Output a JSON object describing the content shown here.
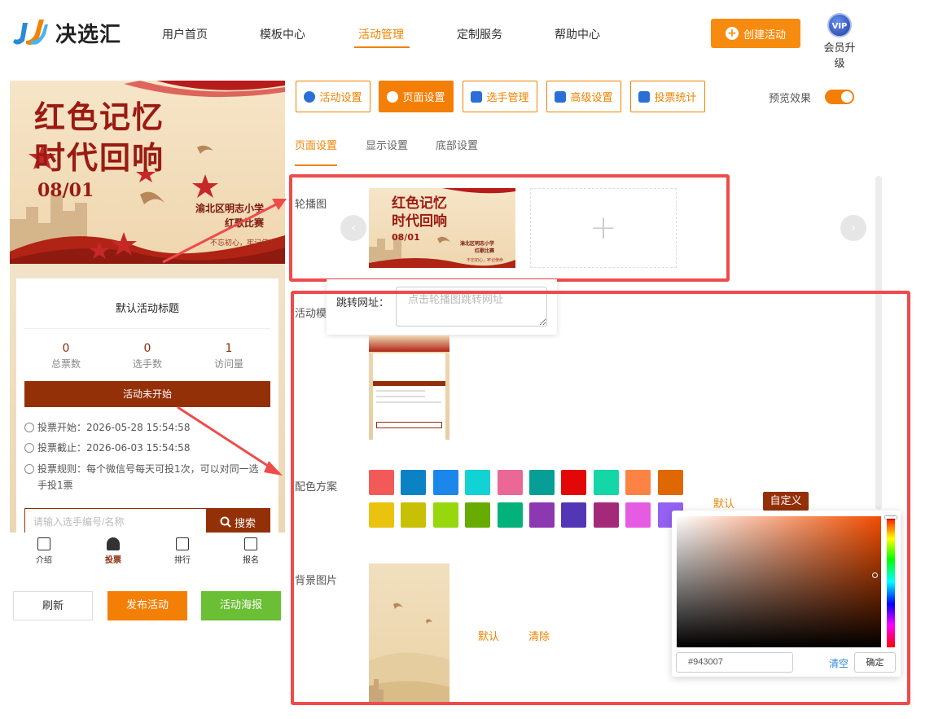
{
  "header": {
    "logo_text": "决选汇",
    "nav": [
      "用户首页",
      "模板中心",
      "活动管理",
      "定制服务",
      "帮助中心"
    ],
    "active_nav": "活动管理",
    "create_button": "创建活动",
    "vip_badge": "VIP",
    "vip_label": "会员升级"
  },
  "preview": {
    "banner_title_line1": "红色记忆",
    "banner_title_line2": "时代回响",
    "banner_date": "08/01",
    "banner_school": "渝北区明志小学",
    "banner_school2": "红歌比赛",
    "banner_slogan": "不忘初心，牢记使命",
    "card_title": "默认活动标题",
    "stats": [
      {
        "value": "0",
        "label": "总票数"
      },
      {
        "value": "0",
        "label": "选手数"
      },
      {
        "value": "1",
        "label": "访问量"
      }
    ],
    "status": "活动未开始",
    "vote_start": "投票开始：2026-05-28 15:54:58",
    "vote_end": "投票截止：2026-06-03 15:54:58",
    "vote_rule": "投票规则：每个微信号每天可投1次，可以对同一选手投1票",
    "search_placeholder": "请输入选手编号/名称",
    "search_button": "搜索",
    "tabs": [
      "介绍",
      "投票",
      "排行",
      "报名"
    ],
    "active_tab": "投票",
    "buttons": {
      "refresh": "刷新",
      "publish": "发布活动",
      "poster": "活动海报"
    }
  },
  "settings": {
    "toolbar": [
      "活动设置",
      "页面设置",
      "选手管理",
      "高级设置",
      "投票统计"
    ],
    "active_tool": "页面设置",
    "preview_label": "预览效果",
    "preview_on": true,
    "subtabs": [
      "页面设置",
      "显示设置",
      "底部设置"
    ],
    "active_subtab": "页面设置",
    "carousel_label": "轮播图",
    "jump_url_label": "跳转网址：",
    "jump_url_placeholder": "点击轮播图跳转网址",
    "template_label": "活动模",
    "color_label": "配色方案",
    "bg_label": "背景图片",
    "default_link": "默认",
    "custom_tag": "自定义",
    "bg_default": "默认",
    "bg_clear": "清除",
    "swatches_row1": [
      "#f25a5a",
      "#0b82c4",
      "#1b87eb",
      "#12d3d3",
      "#e96896",
      "#079e96",
      "#e30808",
      "#15d6a6",
      "#fd8345",
      "#e06803"
    ],
    "swatches_row2": [
      "#e9c30d",
      "#c8c004",
      "#96d80d",
      "#68ab03",
      "#03b17a",
      "#8c38b1",
      "#5336b6",
      "#a42a79",
      "#e55ce2",
      "#9461f2"
    ],
    "picker": {
      "hex": "#943007",
      "clear": "清空",
      "ok": "确定"
    }
  }
}
